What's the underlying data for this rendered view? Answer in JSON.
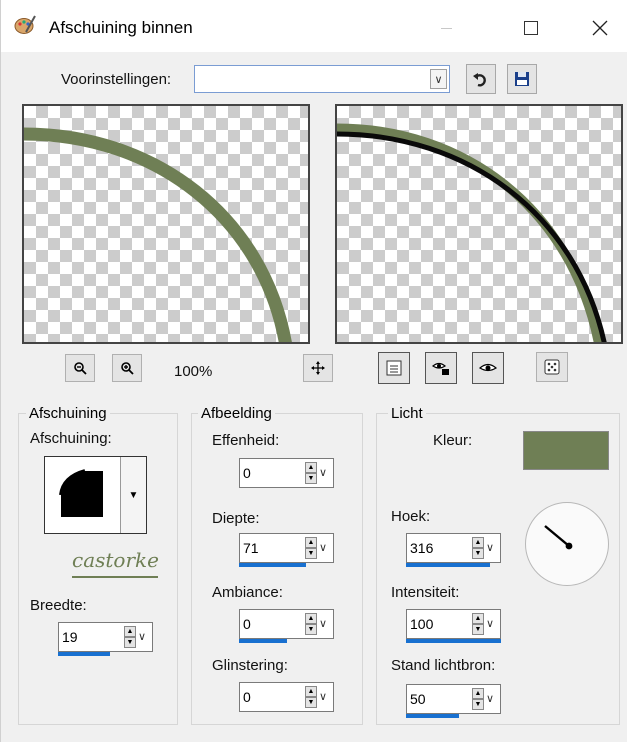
{
  "window": {
    "title": "Afschuining binnen",
    "app_icon": "palette-brush-icon"
  },
  "presets": {
    "label": "Voorinstellingen:",
    "value": ""
  },
  "zoom": {
    "level": "100%"
  },
  "groups": {
    "bevel": {
      "title": "Afschuining",
      "bevel_label": "Afschuining:",
      "width_label": "Breedte:",
      "width_value": "19",
      "width_fill": 0.55
    },
    "image": {
      "title": "Afbeelding",
      "smoothness_label": "Effenheid:",
      "smoothness_value": "0",
      "smoothness_fill": 0.0,
      "depth_label": "Diepte:",
      "depth_value": "71",
      "depth_fill": 0.71,
      "ambience_label": "Ambiance:",
      "ambience_value": "0",
      "ambience_fill": 0.5,
      "shininess_label": "Glinstering:",
      "shininess_value": "0",
      "shininess_fill": 0.0
    },
    "light": {
      "title": "Licht",
      "color_label": "Kleur:",
      "color_value": "#6f7f55",
      "angle_label": "Hoek:",
      "angle_value": "316",
      "angle_fill": 0.88,
      "intensity_label": "Intensiteit:",
      "intensity_value": "100",
      "intensity_fill": 1.0,
      "elevation_label": "Stand lichtbron:",
      "elevation_value": "50",
      "elevation_fill": 0.56
    }
  },
  "watermark": "castorke",
  "colors": {
    "stroke_green": "#6f7f55",
    "accent_blue": "#1870d0",
    "window_bg": "#f0f0f0"
  }
}
